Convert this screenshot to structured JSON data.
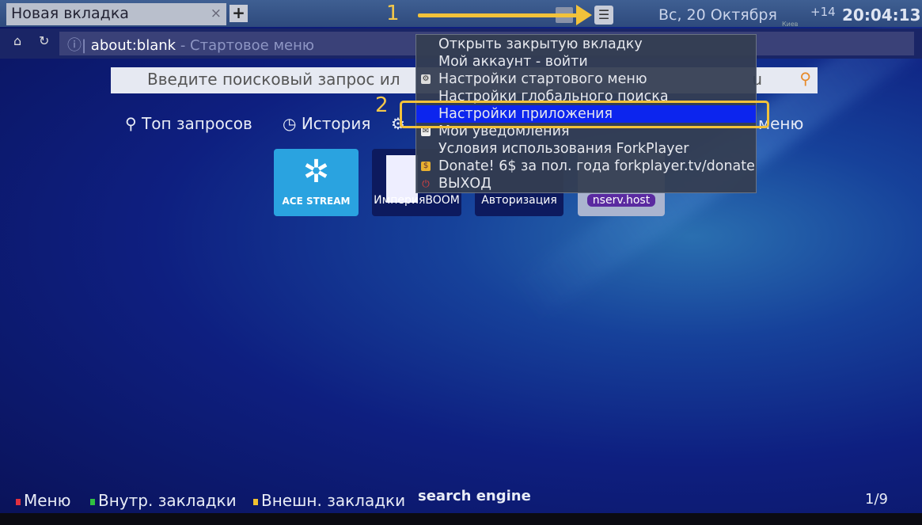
{
  "tab": {
    "title": "Новая вкладка",
    "close": "×",
    "new_tab": "+"
  },
  "annotations": {
    "step1": "1",
    "step2": "2",
    "highlight_color": "#f2c23a"
  },
  "status": {
    "date": "Вс, 20 Октября",
    "city": "Киев",
    "tz": "+14",
    "time": "20:04:13"
  },
  "address": {
    "url": "about:blank",
    "title": " - Стартовое меню"
  },
  "search": {
    "placeholder": "Введите поисковый запрос ил",
    "suffix": "u"
  },
  "links": {
    "top": "Топ запросов",
    "history": "История",
    "menu_tail": "меню"
  },
  "tiles": [
    {
      "label": "ACE STREAM",
      "color": "#2aa3e0"
    },
    {
      "label": "ИмперияBOOM"
    },
    {
      "label": "Авторизация"
    },
    {
      "label": "nserv.host"
    }
  ],
  "dropdown": {
    "items": [
      {
        "label": "Открыть закрытую вкладку",
        "icon": ""
      },
      {
        "label": "Мой аккаунт - войти",
        "icon": ""
      },
      {
        "label": "Настройки стартового меню",
        "icon": "settings-icon"
      },
      {
        "label": "Настройки глобального поиска",
        "icon": ""
      },
      {
        "label": "Настройки приложения",
        "icon": "",
        "selected": true
      },
      {
        "label": "Мои уведомления",
        "icon": "mail-icon"
      },
      {
        "label": "Условия использования ForkPlayer",
        "icon": ""
      },
      {
        "label": "Donate! 6$ за пол. года forkplayer.tv/donate",
        "icon": "donate-icon"
      },
      {
        "label": "ВЫХОД",
        "icon": "power-icon"
      }
    ],
    "selected_color": "#0c25ee"
  },
  "footer": {
    "menu": "Меню",
    "internal": "Внутр. закладки",
    "external": "Внешн. закладки",
    "engine": "search engine",
    "page": "1/9"
  }
}
